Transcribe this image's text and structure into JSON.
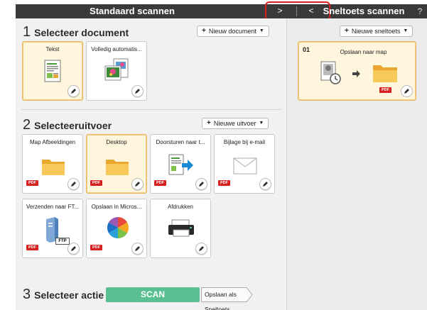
{
  "header": {
    "left_title": "Standaard scannen",
    "next_glyph": ">",
    "prev_glyph": "<",
    "right_title": "Sneltoets scannen",
    "help": "?"
  },
  "section1": {
    "number": "1",
    "title": "Selecteer document",
    "new_button": "Nieuw document",
    "cards": [
      {
        "label": "Tekst",
        "selected": true,
        "icon": "text-document-icon"
      },
      {
        "label": "Volledig automatis...",
        "selected": false,
        "icon": "photo-document-icon"
      }
    ]
  },
  "section2": {
    "number": "2",
    "title": "Selecteeruitvoer",
    "new_button": "Nieuwe uitvoer",
    "cards": [
      {
        "label": "Map Afbeeldingen",
        "pdf": "PDF",
        "icon": "folder-icon"
      },
      {
        "label": "Desktop",
        "pdf": "PDF",
        "icon": "folder-icon",
        "selected": true
      },
      {
        "label": "Doorsturen naar t...",
        "pdf": "PDF",
        "icon": "forward-icon"
      },
      {
        "label": "Bijlage bij e-mail",
        "pdf": "PDF",
        "icon": "mail-icon"
      },
      {
        "label": "Verzenden naar FT...",
        "pdf": "PDF",
        "icon": "ftp-icon",
        "ftp": "FTP"
      },
      {
        "label": "Opslaan in Micros...",
        "pdf": "PDF",
        "icon": "sharepoint-icon"
      },
      {
        "label": "Afdrukken",
        "icon": "printer-icon"
      }
    ]
  },
  "section3": {
    "number": "3",
    "title": "Selecteer actie",
    "scan_button": "SCAN",
    "save_shortcut": "Opslaan als Sneltoets"
  },
  "shortcuts": {
    "new_button": "Nieuwe sneltoets",
    "card": {
      "number": "01",
      "title": "Opslaan naar map",
      "pdf": "PDF"
    }
  },
  "colors": {
    "header_bg": "#3a3a3a",
    "accent_selected": "#eab55c",
    "scan_green": "#5bbf94",
    "pdf_red": "#d72020",
    "highlight_red": "#d62020"
  }
}
